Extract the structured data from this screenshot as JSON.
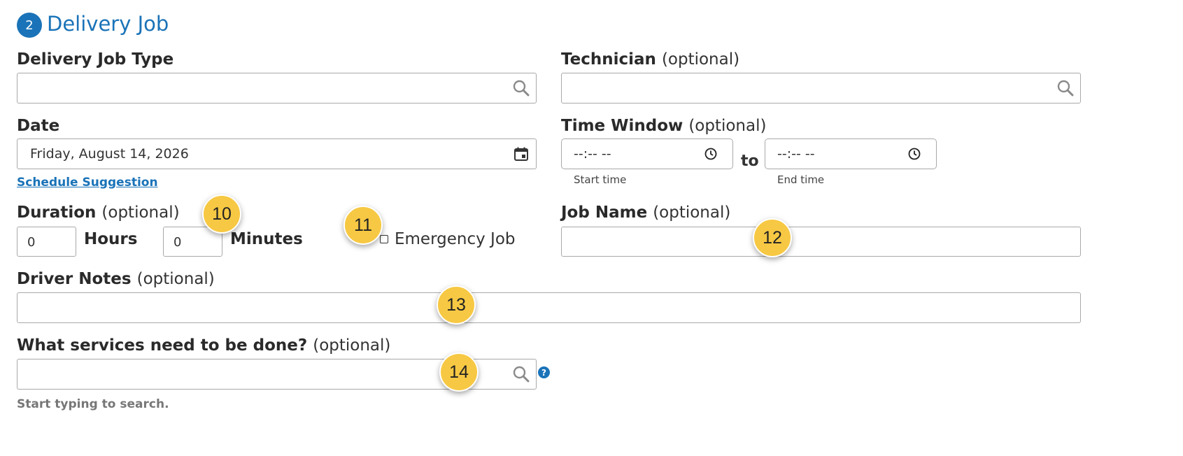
{
  "section": {
    "number": "2",
    "title": "Delivery Job"
  },
  "delivery_job_type": {
    "label": "Delivery Job Type",
    "value": ""
  },
  "technician": {
    "label": "Technician",
    "optional": "(optional)",
    "value": ""
  },
  "date": {
    "label": "Date",
    "value": "Friday, August 14, 2026",
    "link": "Schedule Suggestion"
  },
  "time_window": {
    "label": "Time Window",
    "optional": "(optional)",
    "start_placeholder": "--:-- --",
    "start_caption": "Start time",
    "separator": "to",
    "end_placeholder": "--:-- --",
    "end_caption": "End time"
  },
  "duration": {
    "label": "Duration",
    "optional": "(optional)",
    "hours_value": "0",
    "hours_label": "Hours",
    "minutes_value": "0",
    "minutes_label": "Minutes"
  },
  "emergency": {
    "label": "Emergency Job",
    "checked": false
  },
  "job_name": {
    "label": "Job Name",
    "optional": "(optional)",
    "value": ""
  },
  "driver_notes": {
    "label": "Driver Notes",
    "optional": "(optional)",
    "value": ""
  },
  "services": {
    "label": "What services need to be done?",
    "optional": "(optional)",
    "value": "",
    "hint": "Start typing to search.",
    "help_icon": "?"
  },
  "markers": [
    "10",
    "11",
    "12",
    "13",
    "14"
  ],
  "colors": {
    "accent": "#1a73b8",
    "marker": "#f7c843",
    "border": "#a9a9a9",
    "hint": "#777777"
  }
}
